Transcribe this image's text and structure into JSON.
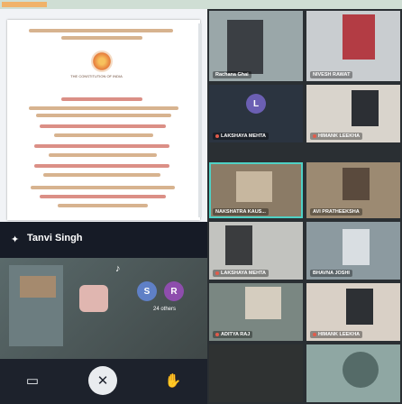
{
  "presenter": {
    "name": "Tanvi Singh"
  },
  "document": {
    "heading": "THE CONSTITUTION OF INDIA",
    "header_lines": [
      "Maharaja Surajmal Brij University",
      "Preamble"
    ]
  },
  "controls": [
    {
      "name": "camera-toggle-button",
      "icon": "camera-icon",
      "glyph": "▭"
    },
    {
      "name": "leave-call-button",
      "icon": "pin-off-icon",
      "glyph": "✕"
    },
    {
      "name": "raise-hand-button",
      "icon": "hand-icon",
      "glyph": "✋"
    }
  ],
  "self_tile": {
    "others_label": "24 others",
    "initials_s": "S",
    "initials_r": "R"
  },
  "participants": [
    {
      "id": "p1",
      "name": "Rachana Ghai"
    },
    {
      "id": "p2",
      "name": "NIVESH RAWAT"
    },
    {
      "id": "p3",
      "name": "LAKSHAYA MEHTA",
      "initial": "L"
    },
    {
      "id": "p4",
      "name": "HIMANK LEEKHA"
    },
    {
      "id": "p5",
      "name": "NAKSHATRA KAUS..."
    },
    {
      "id": "p6",
      "name": "AVI PRATHEEKSHA"
    },
    {
      "id": "p7",
      "name": "LAKSHAYA MEHTA"
    },
    {
      "id": "p8",
      "name": "BHAVNA JOSHI"
    },
    {
      "id": "p9",
      "name": "ADITYA RAJ"
    },
    {
      "id": "p10",
      "name": "HIMANK LEEKHA"
    }
  ],
  "colors": {
    "accent": "#4fd1c5",
    "background": "#d8e7dc",
    "bar": "#1d222c"
  }
}
